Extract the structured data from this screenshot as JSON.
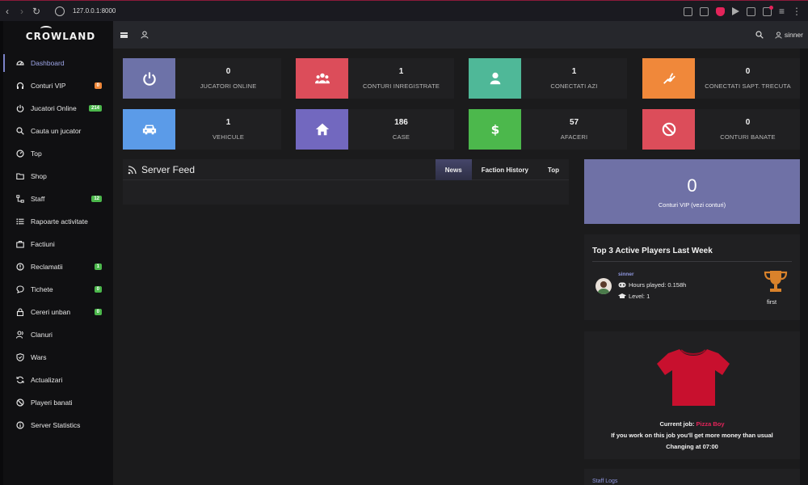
{
  "browser": {
    "url": "127.0.0.1:8000",
    "back_icon": "chevron-left-icon",
    "forward_icon": "chevron-right-icon",
    "reload_icon": "reload-icon"
  },
  "brand": {
    "name": "CROWLAND"
  },
  "sidebar": {
    "items": [
      {
        "label": "Dashboard",
        "icon": "dashboard-icon",
        "active": true,
        "badge": ""
      },
      {
        "label": "Conturi VIP",
        "icon": "headset-icon",
        "badge": "0",
        "badge_color": "#f0883a"
      },
      {
        "label": "Jucatori Online",
        "icon": "power-icon",
        "badge": "214",
        "badge_color": "#4cb84c"
      },
      {
        "label": "Cauta un jucator",
        "icon": "search-icon",
        "badge": ""
      },
      {
        "label": "Top",
        "icon": "gauge-icon",
        "badge": ""
      },
      {
        "label": "Shop",
        "icon": "folder-icon",
        "badge": ""
      },
      {
        "label": "Staff",
        "icon": "network-icon",
        "badge": "12",
        "badge_color": "#4cb84c"
      },
      {
        "label": "Rapoarte activitate",
        "icon": "list-icon",
        "badge": ""
      },
      {
        "label": "Factiuni",
        "icon": "briefcase-icon",
        "badge": ""
      },
      {
        "label": "Reclamatii",
        "icon": "alert-icon",
        "badge": "1",
        "badge_color": "#4cb84c"
      },
      {
        "label": "Tichete",
        "icon": "chat-icon",
        "badge": "0",
        "badge_color": "#4cb84c"
      },
      {
        "label": "Cereri unban",
        "icon": "lock-icon",
        "badge": "0",
        "badge_color": "#4cb84c"
      },
      {
        "label": "Clanuri",
        "icon": "user-group-icon",
        "badge": ""
      },
      {
        "label": "Wars",
        "icon": "shield-icon",
        "badge": ""
      },
      {
        "label": "Actualizari",
        "icon": "refresh-icon",
        "badge": ""
      },
      {
        "label": "Playeri banati",
        "icon": "ban-icon",
        "badge": ""
      },
      {
        "label": "Server Statistics",
        "icon": "info-icon",
        "badge": ""
      }
    ]
  },
  "header": {
    "username": "sinner"
  },
  "stats": [
    {
      "value": "0",
      "label": "JUCATORI ONLINE",
      "icon": "power-icon",
      "color": "#6d72a8"
    },
    {
      "value": "1",
      "label": "CONTURI INREGISTRATE",
      "icon": "users-icon",
      "color": "#dc4d5a"
    },
    {
      "value": "1",
      "label": "CONECTATI AZI",
      "icon": "user-icon",
      "color": "#4fb898"
    },
    {
      "value": "0",
      "label": "CONECTATI SAPT. TRECUTA",
      "icon": "plug-icon",
      "color": "#f0883a"
    },
    {
      "value": "1",
      "label": "VEHICULE",
      "icon": "car-icon",
      "color": "#5b9be8"
    },
    {
      "value": "186",
      "label": "CASE",
      "icon": "home-icon",
      "color": "#7268bf"
    },
    {
      "value": "57",
      "label": "AFACERI",
      "icon": "dollar-icon",
      "color": "#4cb84c"
    },
    {
      "value": "0",
      "label": "CONTURI BANATE",
      "icon": "ban-icon",
      "color": "#dc4d5a"
    }
  ],
  "feed": {
    "title": "Server Feed",
    "tabs": [
      "News",
      "Faction History",
      "Top"
    ],
    "active_tab": "News"
  },
  "vip": {
    "value": "0",
    "label": "Conturi VIP (vezi conturi)"
  },
  "top3": {
    "title": "Top 3 Active Players Last Week",
    "player": {
      "name": "sinner",
      "hours": "Hours played: 0.158h",
      "level": "Level: 1",
      "place": "first"
    }
  },
  "job": {
    "current_label": "Current job:",
    "current_job": "Pizza Boy",
    "bonus_text": "If you work on this job you'll get more money than usual",
    "changing_text": "Changing at 07:00",
    "shirt_color": "#c8102e"
  },
  "staff_logs": {
    "title": "Staff Logs"
  }
}
